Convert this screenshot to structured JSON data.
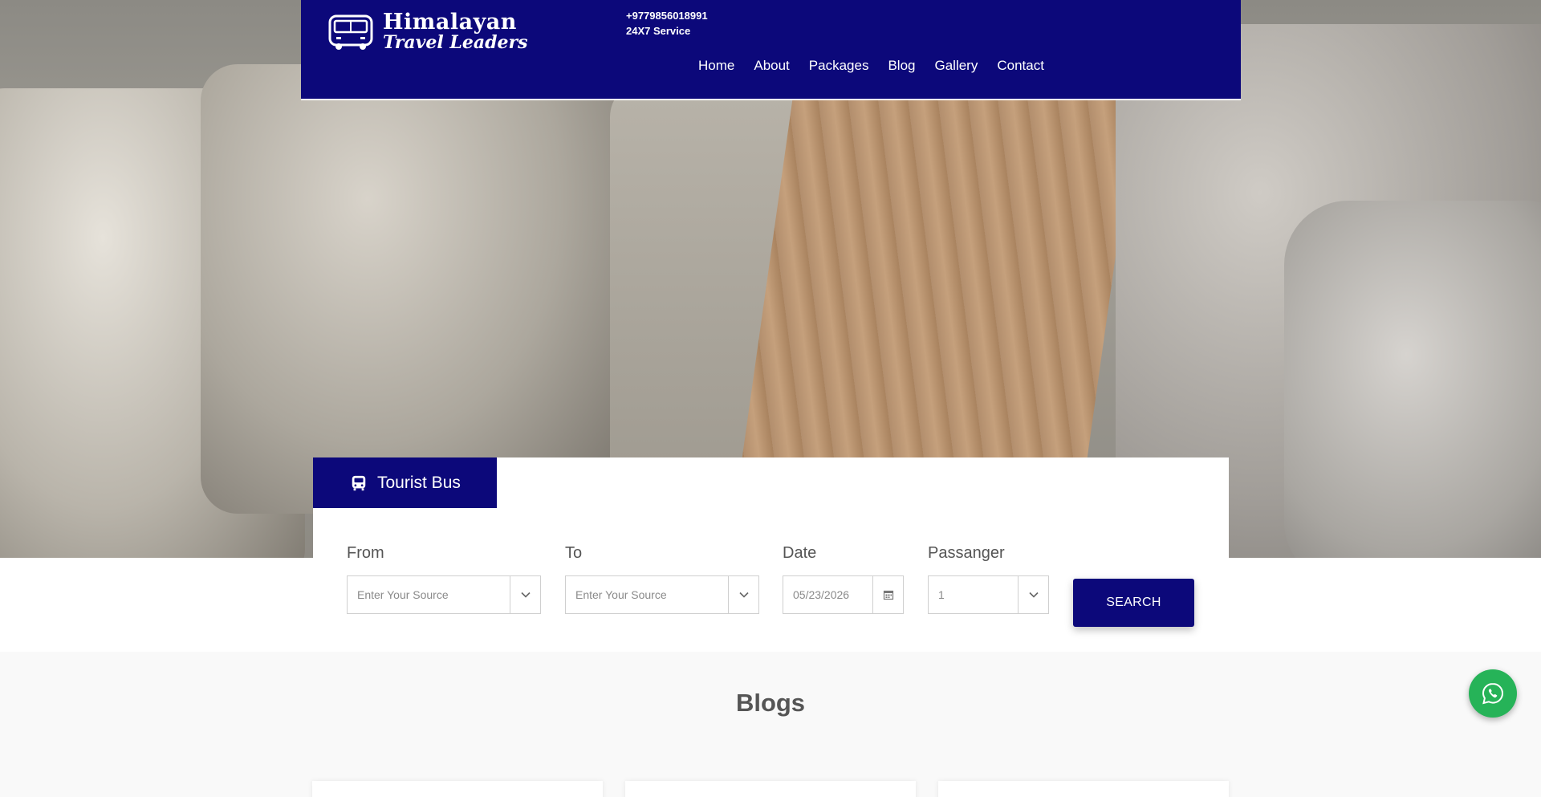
{
  "brand": {
    "line1": "Himalayan",
    "line2": "Travel Leaders"
  },
  "contact": {
    "phone": "+9779856018991",
    "service": "24X7 Service"
  },
  "nav": [
    {
      "label": "Home"
    },
    {
      "label": "About"
    },
    {
      "label": "Packages"
    },
    {
      "label": "Blog"
    },
    {
      "label": "Gallery"
    },
    {
      "label": "Contact"
    }
  ],
  "search": {
    "tab_label": "Tourist Bus",
    "tab_icon": "bus-icon",
    "from": {
      "label": "From",
      "placeholder": "Enter Your Source"
    },
    "to": {
      "label": "To",
      "placeholder": "Enter Your Source"
    },
    "date": {
      "label": "Date",
      "value": "05/23/2026"
    },
    "passenger": {
      "label": "Passanger",
      "value": "1"
    },
    "button_label": "SEARCH"
  },
  "blogs": {
    "title": "Blogs"
  },
  "colors": {
    "primary": "#0c087a",
    "whatsapp": "#26b358",
    "white": "#ffffff"
  }
}
